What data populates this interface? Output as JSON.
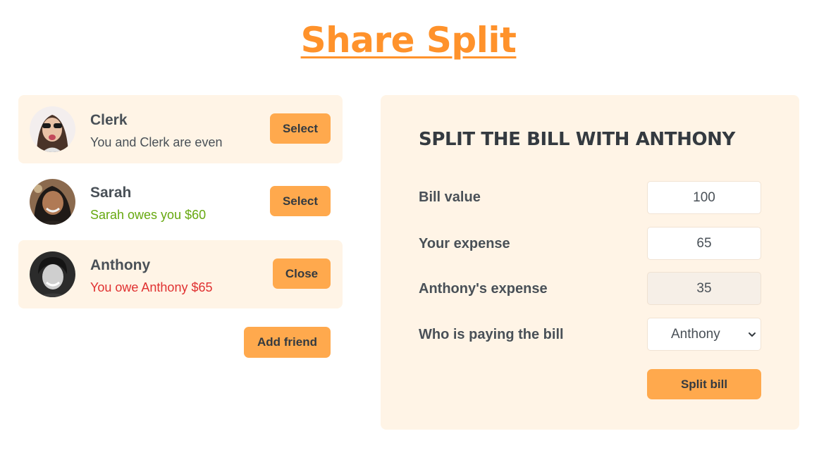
{
  "app": {
    "title": "Share Split"
  },
  "friends": [
    {
      "name": "Clerk",
      "status": "You and Clerk are even",
      "status_type": "even",
      "button": "Select",
      "selected": false
    },
    {
      "name": "Sarah",
      "status": "Sarah owes you $60",
      "status_type": "owed",
      "button": "Select",
      "selected": false
    },
    {
      "name": "Anthony",
      "status": "You owe Anthony $65",
      "status_type": "owe",
      "button": "Close",
      "selected": true
    }
  ],
  "add_friend_label": "Add friend",
  "split_form": {
    "title": "SPLIT THE BILL WITH ANTHONY",
    "bill_label": "Bill value",
    "bill_value": "100",
    "your_expense_label": "Your expense",
    "your_expense_value": "65",
    "friend_expense_label": "Anthony's expense",
    "friend_expense_value": "35",
    "payer_label": "Who is paying the bill",
    "payer_value": "Anthony",
    "submit_label": "Split bill"
  },
  "colors": {
    "accent": "#ff922b",
    "button": "#ffa94d",
    "panel_bg": "#fff4e6",
    "owed_green": "#66a80f",
    "owe_red": "#e03131"
  },
  "icons": [
    "chevron-down-icon"
  ]
}
